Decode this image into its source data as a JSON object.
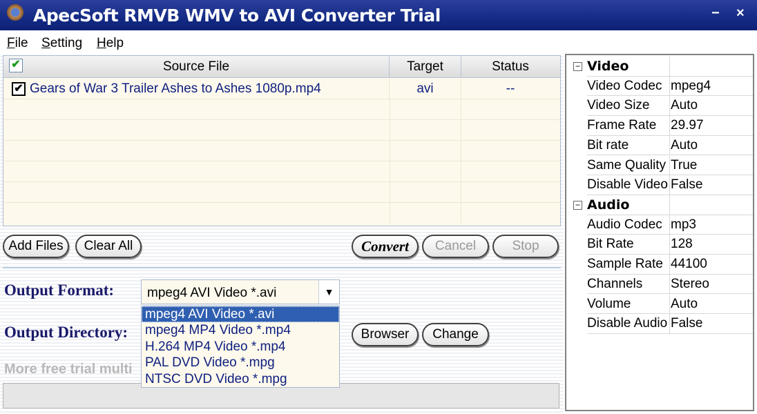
{
  "window": {
    "title": "ApecSoft RMVB WMV to AVI Converter Trial",
    "minimize": "−",
    "close": "×"
  },
  "menu": [
    {
      "label": "File",
      "u": "F",
      "rest": "ile"
    },
    {
      "label": "Setting",
      "u": "S",
      "rest": "etting"
    },
    {
      "label": "Help",
      "u": "H",
      "rest": "elp"
    }
  ],
  "table": {
    "headers": {
      "source": "Source File",
      "target": "Target",
      "status": "Status"
    },
    "rows": [
      {
        "checked": true,
        "source": "Gears of War 3 Trailer Ashes to Ashes 1080p.mp4",
        "target": "avi",
        "status": "--"
      }
    ]
  },
  "buttons": {
    "add": "Add Files",
    "clear": "Clear All",
    "convert": "Convert",
    "cancel": "Cancel",
    "stop": "Stop",
    "browser": "Browser",
    "change": "Change"
  },
  "output": {
    "format_label": "Output Format:",
    "format_value": "mpeg4 AVI Video *.avi",
    "dir_label": "Output Directory:",
    "options": [
      "mpeg4 AVI Video *.avi",
      "mpeg4 MP4 Video *.mp4",
      "H.264 MP4 Video *.mp4",
      "PAL DVD Video *.mpg",
      "NTSC DVD Video *.mpg"
    ]
  },
  "trial_text": "More free trial multi",
  "properties": {
    "video": {
      "title": "Video",
      "items": [
        [
          "Video Codec",
          "mpeg4"
        ],
        [
          "Video Size",
          "Auto"
        ],
        [
          "Frame Rate",
          "29.97"
        ],
        [
          "Bit rate",
          "Auto"
        ],
        [
          "Same Quality",
          "True"
        ],
        [
          "Disable Video",
          "False"
        ]
      ]
    },
    "audio": {
      "title": "Audio",
      "items": [
        [
          "Audio Codec",
          "mp3"
        ],
        [
          "Bit Rate",
          "128"
        ],
        [
          "Sample Rate",
          "44100"
        ],
        [
          "Channels",
          "Stereo"
        ],
        [
          "Volume",
          "Auto"
        ],
        [
          "Disable Audio",
          "False"
        ]
      ]
    }
  }
}
